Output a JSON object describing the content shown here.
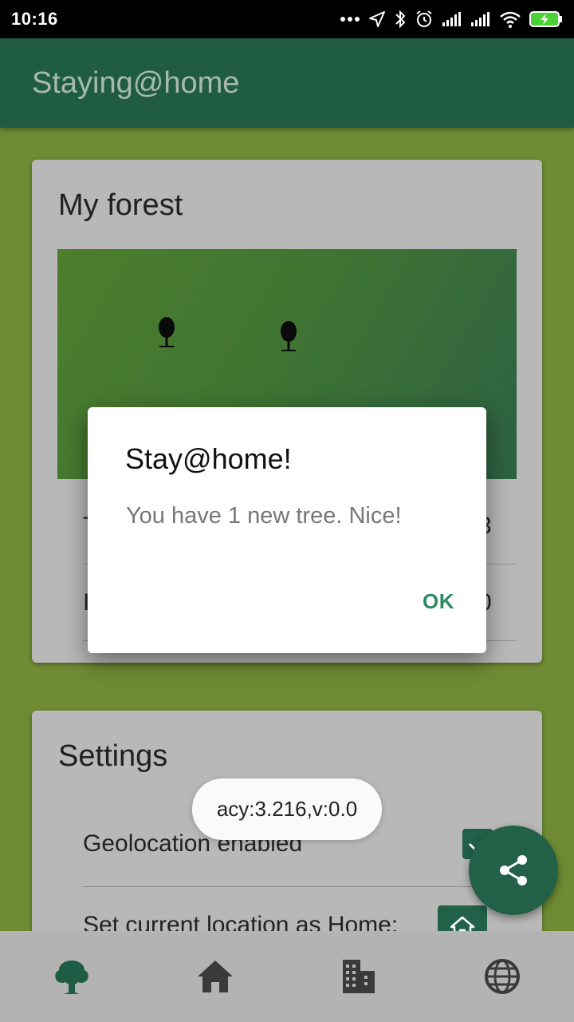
{
  "status_bar": {
    "time": "10:16",
    "icons": [
      "more-dots-icon",
      "location-arrow-icon",
      "bluetooth-icon",
      "alarm-icon",
      "signal-icon",
      "signal-icon",
      "wifi-icon",
      "battery-charging-icon"
    ]
  },
  "app_bar": {
    "title": "Staying@home"
  },
  "forest_card": {
    "title": "My forest",
    "trees_count": 2,
    "rows": [
      {
        "label": "T",
        "value": "3"
      },
      {
        "label": "I",
        "value": "0"
      }
    ]
  },
  "settings_card": {
    "title": "Settings",
    "geolocation_label": "Geolocation enabled",
    "geolocation_checked": true,
    "home_label": "Set current location as Home:"
  },
  "dialog": {
    "title": "Stay@home!",
    "message": "You have 1 new tree. Nice!",
    "ok_label": "OK"
  },
  "toast": {
    "text": "acy:3.216,v:0.0"
  },
  "fab": {
    "icon": "share-icon"
  },
  "bottom_nav": {
    "items": [
      {
        "icon": "tree-icon",
        "active": true
      },
      {
        "icon": "home-icon",
        "active": false
      },
      {
        "icon": "building-icon",
        "active": false
      },
      {
        "icon": "globe-icon",
        "active": false
      }
    ]
  },
  "colors": {
    "background": "#6f8b33",
    "app_bar": "#205c43",
    "accent": "#216148",
    "ok_button": "#2e8a63",
    "card": "#b8b8b8",
    "nav": "#b3b3b3"
  }
}
